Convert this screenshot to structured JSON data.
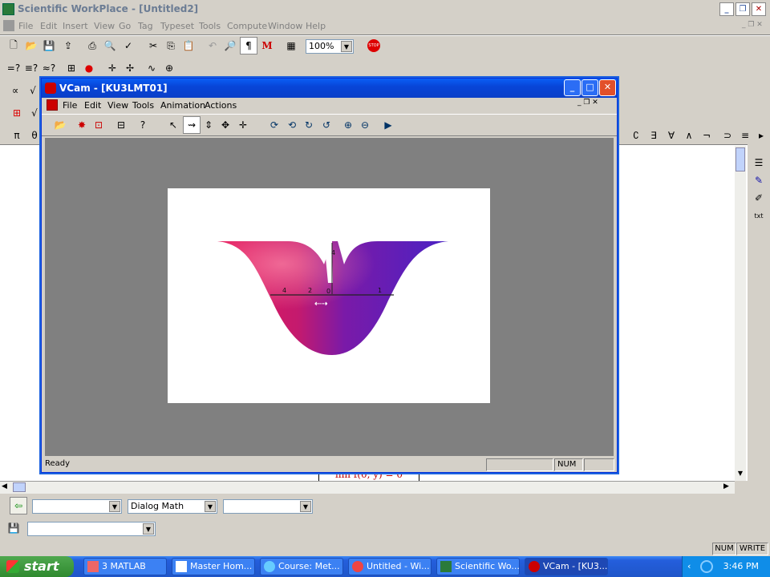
{
  "main_window": {
    "title": "Scientific WorkPlace - [Untitled2]",
    "menu": [
      "File",
      "Edit",
      "Insert",
      "View",
      "Go",
      "Tag",
      "Typeset",
      "Tools",
      "Compute",
      "Window",
      "Help"
    ],
    "zoom": "100%",
    "tag_combo_1": "",
    "tag_combo_2": "Dialog Math",
    "tag_combo_3": "",
    "tag_combo_4": "",
    "doc_formula": "lim f(0, y) = 0",
    "status_num": "NUM",
    "status_write": "WRITE"
  },
  "vcam": {
    "title": "VCam - [KU3LMT01]",
    "menu": [
      "File",
      "Edit",
      "View",
      "Tools",
      "Animation",
      "Actions"
    ],
    "status_text": "Ready",
    "status_num": "NUM",
    "axis_labels": {
      "z": "4",
      "x_left": "4",
      "x_left2": "2",
      "origin": "0",
      "x_right": "1"
    }
  },
  "taskbar": {
    "start": "start",
    "tasks": [
      "3 MATLAB",
      "Master Hom...",
      "Course: Met...",
      "Untitled - Wi...",
      "Scientific Wo...",
      "VCam - [KU3..."
    ],
    "clock": "3:46 PM"
  },
  "colors": {
    "xp_blue": "#245edc",
    "surface_pink": "#d4145a",
    "surface_purple": "#5a1fb8"
  }
}
